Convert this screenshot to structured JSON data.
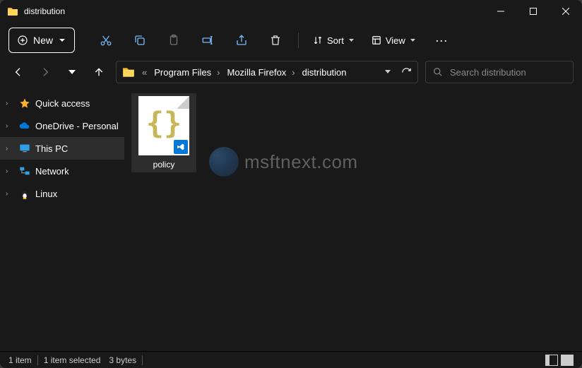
{
  "window": {
    "title": "distribution"
  },
  "toolbar": {
    "new_label": "New",
    "sort_label": "Sort",
    "view_label": "View"
  },
  "breadcrumbs": {
    "items": [
      "Program Files",
      "Mozilla Firefox",
      "distribution"
    ]
  },
  "search": {
    "placeholder": "Search distribution"
  },
  "sidebar": {
    "items": [
      {
        "label": "Quick access"
      },
      {
        "label": "OneDrive - Personal"
      },
      {
        "label": "This PC"
      },
      {
        "label": "Network"
      },
      {
        "label": "Linux"
      }
    ]
  },
  "files": {
    "items": [
      {
        "label": "policy"
      }
    ]
  },
  "status": {
    "count": "1 item",
    "selection": "1 item selected",
    "size": "3 bytes"
  },
  "watermark": {
    "text": "msftnext.com"
  }
}
